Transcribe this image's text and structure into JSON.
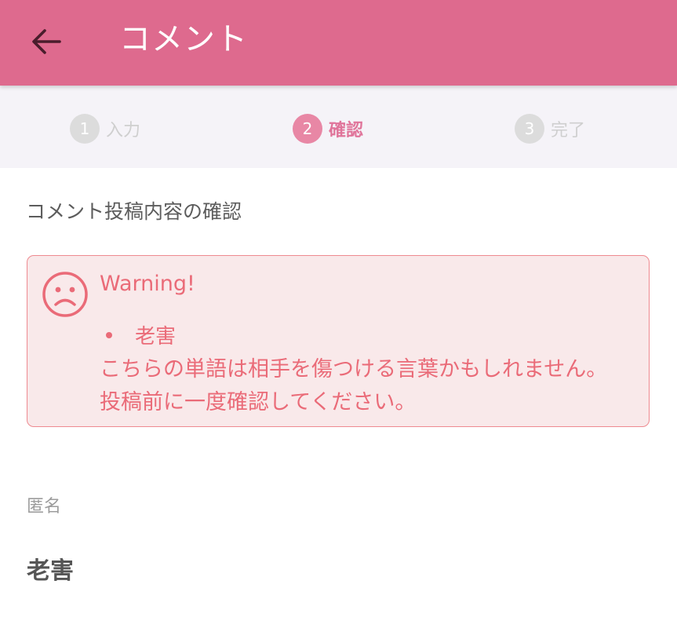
{
  "appbar": {
    "title": "コメント",
    "back_icon": "arrow-left-icon",
    "background_color": "#de6a8e"
  },
  "stepper": {
    "steps": [
      {
        "number": "1",
        "label": "入力",
        "state": "inactive"
      },
      {
        "number": "2",
        "label": "確認",
        "state": "active"
      },
      {
        "number": "3",
        "label": "完了",
        "state": "inactive"
      }
    ],
    "active_color": "#e887a5",
    "inactive_color": "#dcdcdc"
  },
  "main": {
    "section_title": "コメント投稿内容の確認"
  },
  "warning": {
    "icon": "sad-face-icon",
    "title": "Warning!",
    "words": [
      "老害"
    ],
    "message": "こちらの単語は相手を傷つける言葉かもしれません。投稿前に一度確認してください。",
    "color": "#ea6b78",
    "background_color": "#f9e9ea"
  },
  "field": {
    "label": "匿名",
    "value": "老害"
  }
}
